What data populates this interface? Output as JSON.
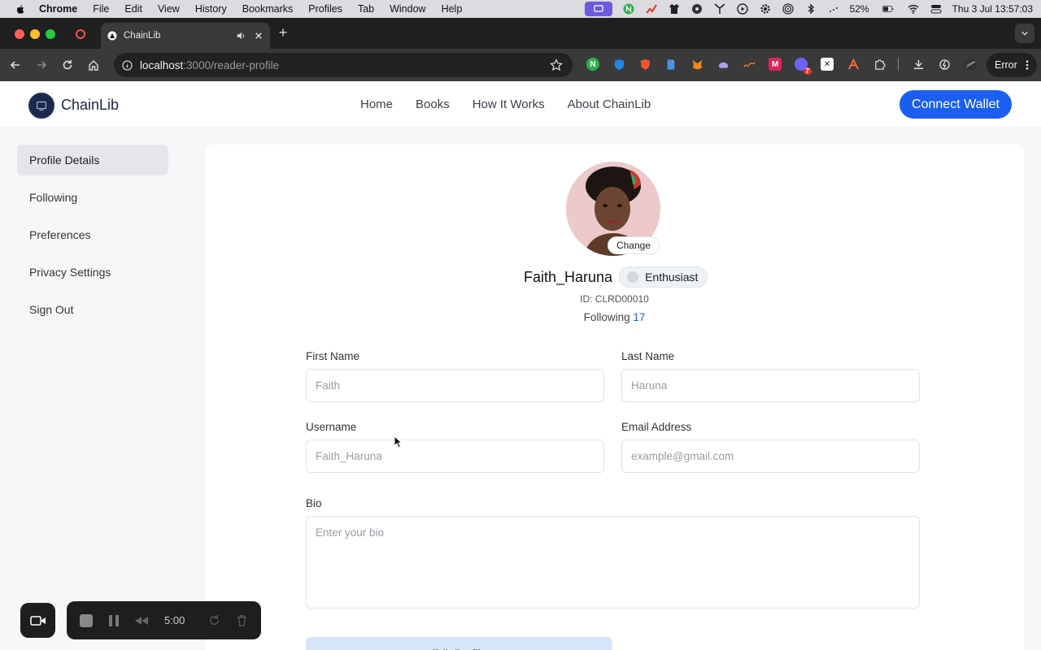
{
  "menubar": {
    "app": "Chrome",
    "items": [
      "File",
      "Edit",
      "View",
      "History",
      "Bookmarks",
      "Profiles",
      "Tab",
      "Window",
      "Help"
    ],
    "battery": "52%",
    "clock": "Thu 3 Jul  13:57:03"
  },
  "browser": {
    "tab_title": "ChainLib",
    "url_host": "localhost",
    "url_rest": ":3000/reader-profile",
    "error_label": "Error"
  },
  "site": {
    "brand": "ChainLib",
    "nav": [
      "Home",
      "Books",
      "How It Works",
      "About ChainLib"
    ],
    "connect_label": "Connect Wallet"
  },
  "sidebar": {
    "items": [
      {
        "label": "Profile Details",
        "active": true
      },
      {
        "label": "Following"
      },
      {
        "label": "Preferences"
      },
      {
        "label": "Privacy Settings"
      },
      {
        "label": "Sign Out"
      }
    ]
  },
  "profile": {
    "change_label": "Change",
    "name": "Faith_Haruna",
    "badge": "Enthusiast",
    "id_text": "ID: CLRD00010",
    "following_label": "Following",
    "following_count": "17"
  },
  "form": {
    "first_name": {
      "label": "First Name",
      "placeholder": "Faith"
    },
    "last_name": {
      "label": "Last Name",
      "placeholder": "Haruna"
    },
    "username": {
      "label": "Username",
      "placeholder": "Faith_Haruna"
    },
    "email": {
      "label": "Email Address",
      "placeholder": "example@gmail.com"
    },
    "bio": {
      "label": "Bio",
      "placeholder": "Enter your bio"
    },
    "submit_label": "Edit Profile"
  },
  "recorder": {
    "time": "5:00"
  },
  "colors": {
    "accent": "#1a5ff0",
    "sidebar_active": "#e6e6ea"
  }
}
